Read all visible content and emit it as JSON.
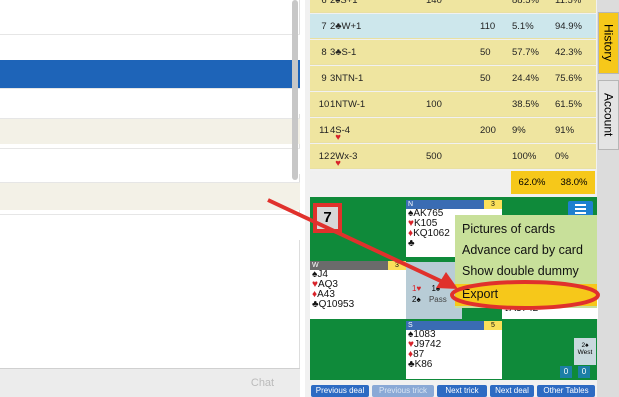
{
  "chat_button": "Chat",
  "tabs": [
    "History",
    "Account"
  ],
  "table_rows": [
    {
      "no": "6",
      "contract": "2♠S+1",
      "ns": "140",
      "ew": "",
      "pct_ns": "88.5%",
      "pct_ew": "11.5%",
      "bg": "#efe5a0"
    },
    {
      "no": "7",
      "contract": "2♣W+1",
      "ns": "",
      "ew": "110",
      "pct_ns": "5.1%",
      "pct_ew": "94.9%",
      "bg": "#cde7ec"
    },
    {
      "no": "8",
      "contract": "3♣S-1",
      "ns": "",
      "ew": "50",
      "pct_ns": "57.7%",
      "pct_ew": "42.3%",
      "bg": "#efe5a0"
    },
    {
      "no": "9",
      "contract": "3NTN-1",
      "ns": "",
      "ew": "50",
      "pct_ns": "24.4%",
      "pct_ew": "75.6%",
      "bg": "#efe5a0"
    },
    {
      "no": "10",
      "contract": "1NTW-1",
      "ns": "100",
      "ew": "",
      "pct_ns": "38.5%",
      "pct_ew": "61.5%",
      "bg": "#efe5a0"
    },
    {
      "no": "11",
      "contract": "4♥S-4",
      "ns": "",
      "ew": "200",
      "pct_ns": "9%",
      "pct_ew": "91%",
      "bg": "#efe5a0"
    },
    {
      "no": "12",
      "contract": "2♥Wx-3",
      "ns": "500",
      "ew": "",
      "pct_ns": "100%",
      "pct_ew": "0%",
      "bg": "#efe5a0"
    }
  ],
  "totals": {
    "ns": "62.0%",
    "ew": "38.0%"
  },
  "board_number": "7",
  "north": {
    "label": "N",
    "score": "3",
    "spades": "AK765",
    "hearts": "K105",
    "diamonds": "KQ1062",
    "clubs": ""
  },
  "west": {
    "label": "W",
    "score": "3",
    "spades": "J4",
    "hearts": "AQ3",
    "diamonds": "A43",
    "clubs": "Q10953"
  },
  "south": {
    "label": "S",
    "score": "5",
    "spades": "1083",
    "hearts": "J9742",
    "diamonds": "87",
    "clubs": "K86"
  },
  "east_partial": "A3742",
  "bidding": {
    "row1_a": "1♥",
    "row1_b": "1♠",
    "row2_a": "2♠",
    "row2_b": "Pass"
  },
  "menu": [
    "Pictures of cards",
    "Advance card by card",
    "Show double dummy",
    "Export"
  ],
  "contract_box": {
    "contract": "2♠",
    "declarer": "West"
  },
  "tricks": {
    "ns": "0",
    "ew": "0"
  },
  "nav_buttons": [
    "Previous deal",
    "Previous trick",
    "Next trick",
    "Next deal",
    "Other Tables"
  ],
  "colors": {
    "accent_blue": "#1e64b8",
    "history_tab": "#f6c81a",
    "felt_green": "#0f8a3a",
    "highlight_red": "#e0312c"
  }
}
